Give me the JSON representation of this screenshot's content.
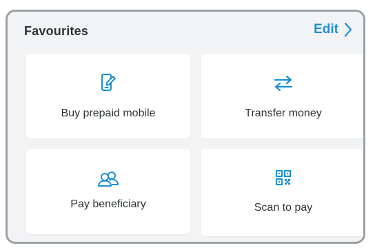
{
  "favourites": {
    "title": "Favourites",
    "edit_label": "Edit",
    "items": [
      {
        "label": "Buy prepaid mobile",
        "icon": "mobile-edit-icon"
      },
      {
        "label": "Transfer money",
        "icon": "transfer-arrows-icon"
      },
      {
        "label": "Pay beneficiary",
        "icon": "people-icon"
      },
      {
        "label": "Scan to pay",
        "icon": "qr-code-icon"
      }
    ]
  },
  "colors": {
    "accent": "#1a8fd1",
    "card_background": "#ffffff",
    "panel_background": "#f2f3f5",
    "text": "#2f3538"
  }
}
